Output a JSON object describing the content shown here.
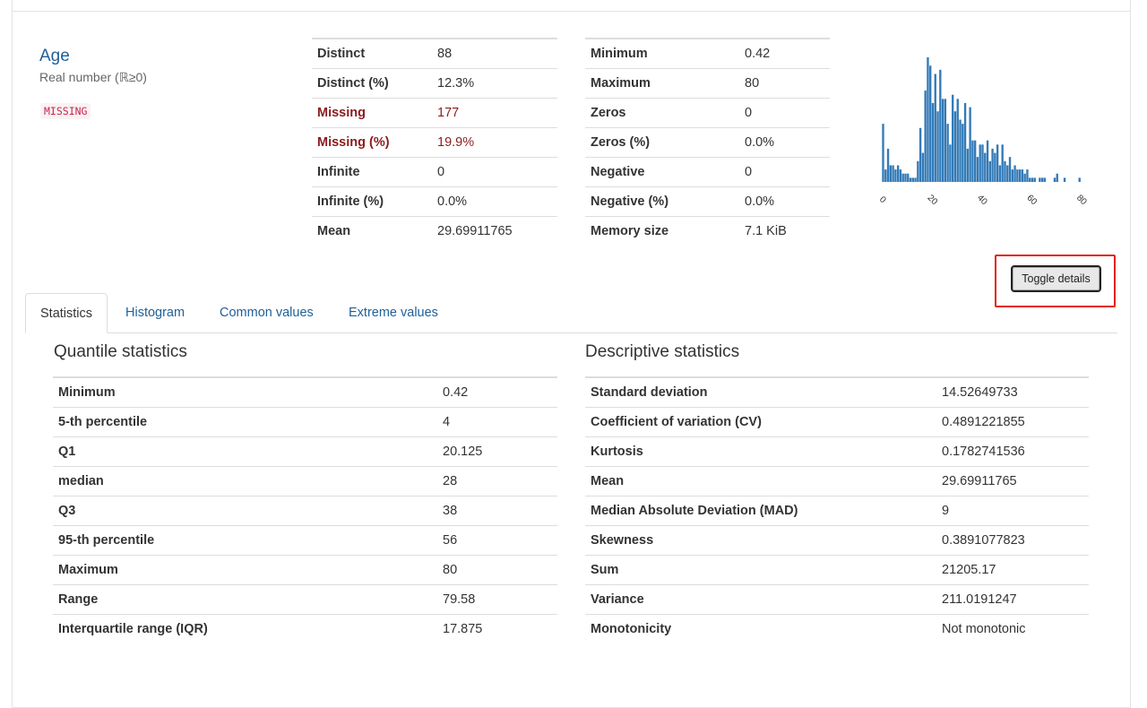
{
  "variable": {
    "name": "Age",
    "type": "Real number (ℝ≥0)",
    "badge": "MISSING"
  },
  "overview_left": [
    {
      "label": "Distinct",
      "value": "88",
      "alert": false
    },
    {
      "label": "Distinct (%)",
      "value": "12.3%",
      "alert": false
    },
    {
      "label": "Missing",
      "value": "177",
      "alert": true
    },
    {
      "label": "Missing (%)",
      "value": "19.9%",
      "alert": true
    },
    {
      "label": "Infinite",
      "value": "0",
      "alert": false
    },
    {
      "label": "Infinite (%)",
      "value": "0.0%",
      "alert": false
    },
    {
      "label": "Mean",
      "value": "29.69911765",
      "alert": false
    }
  ],
  "overview_right": [
    {
      "label": "Minimum",
      "value": "0.42"
    },
    {
      "label": "Maximum",
      "value": "80"
    },
    {
      "label": "Zeros",
      "value": "0"
    },
    {
      "label": "Zeros (%)",
      "value": "0.0%"
    },
    {
      "label": "Negative",
      "value": "0"
    },
    {
      "label": "Negative (%)",
      "value": "0.0%"
    },
    {
      "label": "Memory size",
      "value": "7.1 KiB"
    }
  ],
  "toggle_button": {
    "label": "Toggle details"
  },
  "tabs": [
    {
      "label": "Statistics",
      "active": true
    },
    {
      "label": "Histogram",
      "active": false
    },
    {
      "label": "Common values",
      "active": false
    },
    {
      "label": "Extreme values",
      "active": false
    }
  ],
  "quantile": {
    "title": "Quantile statistics",
    "rows": [
      {
        "label": "Minimum",
        "value": "0.42"
      },
      {
        "label": "5-th percentile",
        "value": "4"
      },
      {
        "label": "Q1",
        "value": "20.125"
      },
      {
        "label": "median",
        "value": "28"
      },
      {
        "label": "Q3",
        "value": "38"
      },
      {
        "label": "95-th percentile",
        "value": "56"
      },
      {
        "label": "Maximum",
        "value": "80"
      },
      {
        "label": "Range",
        "value": "79.58"
      },
      {
        "label": "Interquartile range (IQR)",
        "value": "17.875"
      }
    ]
  },
  "descriptive": {
    "title": "Descriptive statistics",
    "rows": [
      {
        "label": "Standard deviation",
        "value": "14.52649733"
      },
      {
        "label": "Coefficient of variation (CV)",
        "value": "0.4891221855"
      },
      {
        "label": "Kurtosis",
        "value": "0.1782741536"
      },
      {
        "label": "Mean",
        "value": "29.69911765"
      },
      {
        "label": "Median Absolute Deviation (MAD)",
        "value": "9"
      },
      {
        "label": "Skewness",
        "value": "0.3891077823"
      },
      {
        "label": "Sum",
        "value": "21205.17"
      },
      {
        "label": "Variance",
        "value": "211.0191247"
      },
      {
        "label": "Monotonicity",
        "value": "Not monotonic"
      }
    ]
  },
  "histogram": {
    "type": "bar",
    "xlim": [
      0,
      80
    ],
    "ylim": [
      0,
      30
    ],
    "x_ticks": [
      "0",
      "20",
      "40",
      "60",
      "80"
    ],
    "bar_color": "#337ab7",
    "bins": [
      {
        "x": 0.9,
        "y": 14
      },
      {
        "x": 1.9,
        "y": 3
      },
      {
        "x": 2.9,
        "y": 8
      },
      {
        "x": 3.9,
        "y": 4
      },
      {
        "x": 4.9,
        "y": 4
      },
      {
        "x": 5.9,
        "y": 3
      },
      {
        "x": 6.9,
        "y": 4
      },
      {
        "x": 7.9,
        "y": 3
      },
      {
        "x": 8.9,
        "y": 2
      },
      {
        "x": 9.9,
        "y": 2
      },
      {
        "x": 10.9,
        "y": 2
      },
      {
        "x": 11.9,
        "y": 1
      },
      {
        "x": 12.9,
        "y": 1
      },
      {
        "x": 13.9,
        "y": 1
      },
      {
        "x": 14.9,
        "y": 5
      },
      {
        "x": 15.9,
        "y": 13
      },
      {
        "x": 16.9,
        "y": 7
      },
      {
        "x": 17.9,
        "y": 22
      },
      {
        "x": 18.9,
        "y": 30
      },
      {
        "x": 19.9,
        "y": 28
      },
      {
        "x": 20.9,
        "y": 19
      },
      {
        "x": 21.9,
        "y": 26
      },
      {
        "x": 22.9,
        "y": 17
      },
      {
        "x": 23.9,
        "y": 27
      },
      {
        "x": 24.9,
        "y": 20
      },
      {
        "x": 25.9,
        "y": 20
      },
      {
        "x": 26.9,
        "y": 14
      },
      {
        "x": 27.9,
        "y": 9
      },
      {
        "x": 28.9,
        "y": 21
      },
      {
        "x": 29.9,
        "y": 17
      },
      {
        "x": 30.9,
        "y": 20
      },
      {
        "x": 31.9,
        "y": 15
      },
      {
        "x": 32.9,
        "y": 14
      },
      {
        "x": 33.9,
        "y": 19
      },
      {
        "x": 34.9,
        "y": 8
      },
      {
        "x": 35.9,
        "y": 18
      },
      {
        "x": 36.9,
        "y": 10
      },
      {
        "x": 37.9,
        "y": 10
      },
      {
        "x": 38.9,
        "y": 6
      },
      {
        "x": 39.9,
        "y": 9
      },
      {
        "x": 40.9,
        "y": 9
      },
      {
        "x": 41.9,
        "y": 7
      },
      {
        "x": 42.9,
        "y": 10
      },
      {
        "x": 43.9,
        "y": 5
      },
      {
        "x": 44.9,
        "y": 8
      },
      {
        "x": 45.9,
        "y": 7
      },
      {
        "x": 46.9,
        "y": 9
      },
      {
        "x": 47.9,
        "y": 4
      },
      {
        "x": 48.9,
        "y": 9
      },
      {
        "x": 49.9,
        "y": 5
      },
      {
        "x": 50.9,
        "y": 4
      },
      {
        "x": 51.9,
        "y": 6
      },
      {
        "x": 52.9,
        "y": 3
      },
      {
        "x": 53.9,
        "y": 4
      },
      {
        "x": 54.9,
        "y": 3
      },
      {
        "x": 55.9,
        "y": 3
      },
      {
        "x": 56.9,
        "y": 3
      },
      {
        "x": 57.9,
        "y": 2
      },
      {
        "x": 58.9,
        "y": 3
      },
      {
        "x": 59.9,
        "y": 1
      },
      {
        "x": 60.9,
        "y": 1
      },
      {
        "x": 61.9,
        "y": 1
      },
      {
        "x": 63.9,
        "y": 1
      },
      {
        "x": 64.9,
        "y": 1
      },
      {
        "x": 65.9,
        "y": 1
      },
      {
        "x": 69.9,
        "y": 1
      },
      {
        "x": 70.9,
        "y": 2
      },
      {
        "x": 73.9,
        "y": 1
      },
      {
        "x": 79.9,
        "y": 1
      }
    ]
  }
}
